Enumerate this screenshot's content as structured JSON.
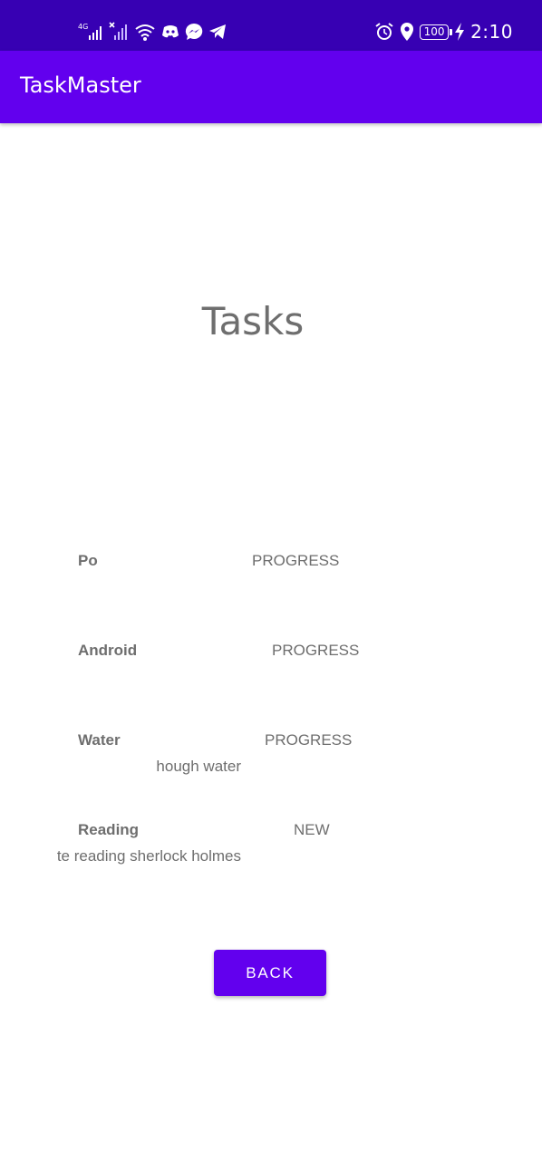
{
  "status_bar": {
    "network_label": "4G",
    "battery_level": "100",
    "time": "2:10",
    "left_icons": [
      "signal-4g-icon",
      "signal-no-sim-icon",
      "wifi-icon",
      "discord-icon",
      "messenger-icon",
      "telegram-icon"
    ],
    "right_icons": [
      "alarm-icon",
      "location-icon",
      "battery-icon",
      "charging-icon"
    ]
  },
  "app_bar": {
    "title": "TaskMaster"
  },
  "page": {
    "title": "Tasks"
  },
  "tasks": [
    {
      "title": "Po",
      "state": "PROGRESS",
      "body": ""
    },
    {
      "title": "Android",
      "state": "PROGRESS",
      "body": ""
    },
    {
      "title": "Water",
      "state": "PROGRESS",
      "body": "hough water"
    },
    {
      "title": "Reading",
      "state": "NEW",
      "body": "te reading sherlock holmes"
    }
  ],
  "actions": {
    "back_label": "BACK"
  },
  "colors": {
    "status_bar": "#3700b3",
    "primary": "#6200ee",
    "text_secondary": "#6e6e6e",
    "background": "#ffffff"
  }
}
